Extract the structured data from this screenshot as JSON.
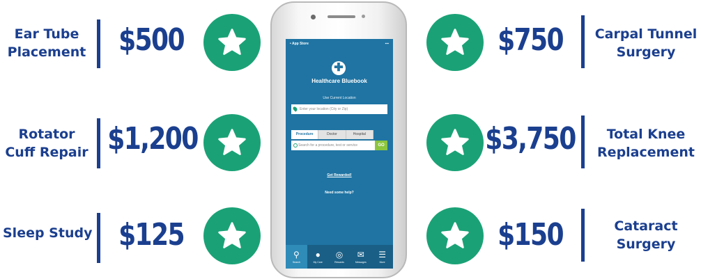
{
  "left": [
    {
      "procedure_line1": "Ear Tube",
      "procedure_line2": "Placement",
      "price": "$500"
    },
    {
      "procedure_line1": "Rotator",
      "procedure_line2": "Cuff Repair",
      "price": "$1,200"
    },
    {
      "procedure_line1": "Sleep Study",
      "procedure_line2": "",
      "price": "$125"
    }
  ],
  "right": [
    {
      "procedure_line1": "Carpal Tunnel",
      "procedure_line2": "Surgery",
      "price": "$750"
    },
    {
      "procedure_line1": "Total Knee",
      "procedure_line2": "Replacement",
      "price": "$3,750"
    },
    {
      "procedure_line1": "Cataract",
      "procedure_line2": "Surgery",
      "price": "$150"
    }
  ],
  "colors": {
    "brand_blue": "#1b3f8f",
    "badge_green": "#1aa276",
    "app_blue": "#1f74a3",
    "go_green": "#8cc63f"
  },
  "icons": {
    "badge": "star-icon",
    "logo": "cross-icon"
  },
  "app": {
    "status_left": "• App Store",
    "status_right": "▪▪▪",
    "title": "Healthcare Bluebook",
    "location_label": "Use Current Location",
    "location_placeholder": "Enter your location (City or Zip)",
    "tabs": [
      "Procedure",
      "Doctor",
      "Hospital"
    ],
    "search_placeholder": "Search for a procedure, test or service",
    "go_label": "GO",
    "link_rewarded": "Get Rewarded!",
    "link_help": "Need some help?",
    "nav": [
      {
        "label": "Search",
        "icon": "search-icon"
      },
      {
        "label": "My Care",
        "icon": "people-icon"
      },
      {
        "label": "Rewards",
        "icon": "award-icon"
      },
      {
        "label": "Messages",
        "icon": "envelope-icon"
      },
      {
        "label": "More",
        "icon": "menu-icon"
      }
    ]
  }
}
